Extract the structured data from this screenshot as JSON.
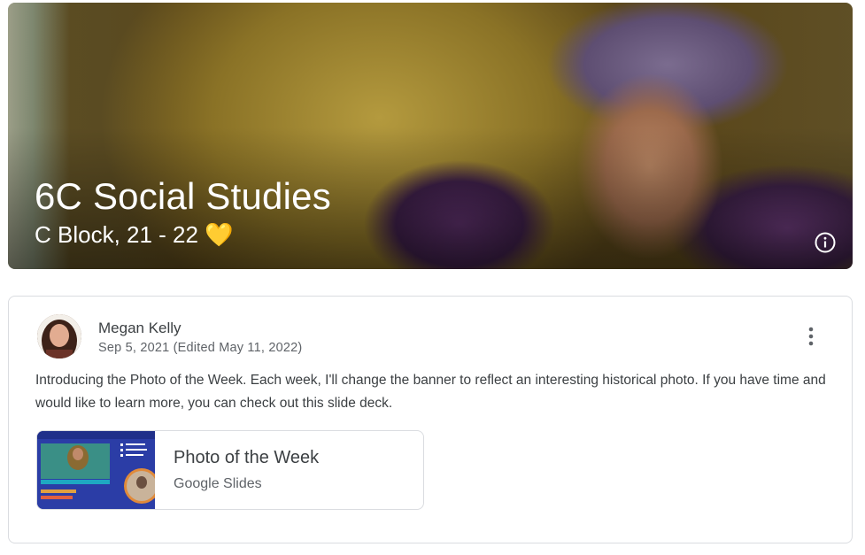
{
  "banner": {
    "class_title": "6C Social Studies",
    "class_section": "C Block, 21 - 22 💛",
    "info_icon": "info-icon"
  },
  "post": {
    "author": "Megan Kelly",
    "date": "Sep 5, 2021 (Edited May 11, 2022)",
    "text": "Introducing the Photo of the Week. Each week, I'll change the banner to reflect an interesting historical photo. If you have time and would like to learn more, you can check out this slide deck.",
    "menu_icon": "more-vert-icon",
    "attachment": {
      "title": "Photo of the Week",
      "type": "Google Slides"
    }
  },
  "colors": {
    "text_primary": "#3c4043",
    "text_secondary": "#5f6368",
    "border": "#dadce0",
    "slide_bg": "#2d3fa8"
  }
}
